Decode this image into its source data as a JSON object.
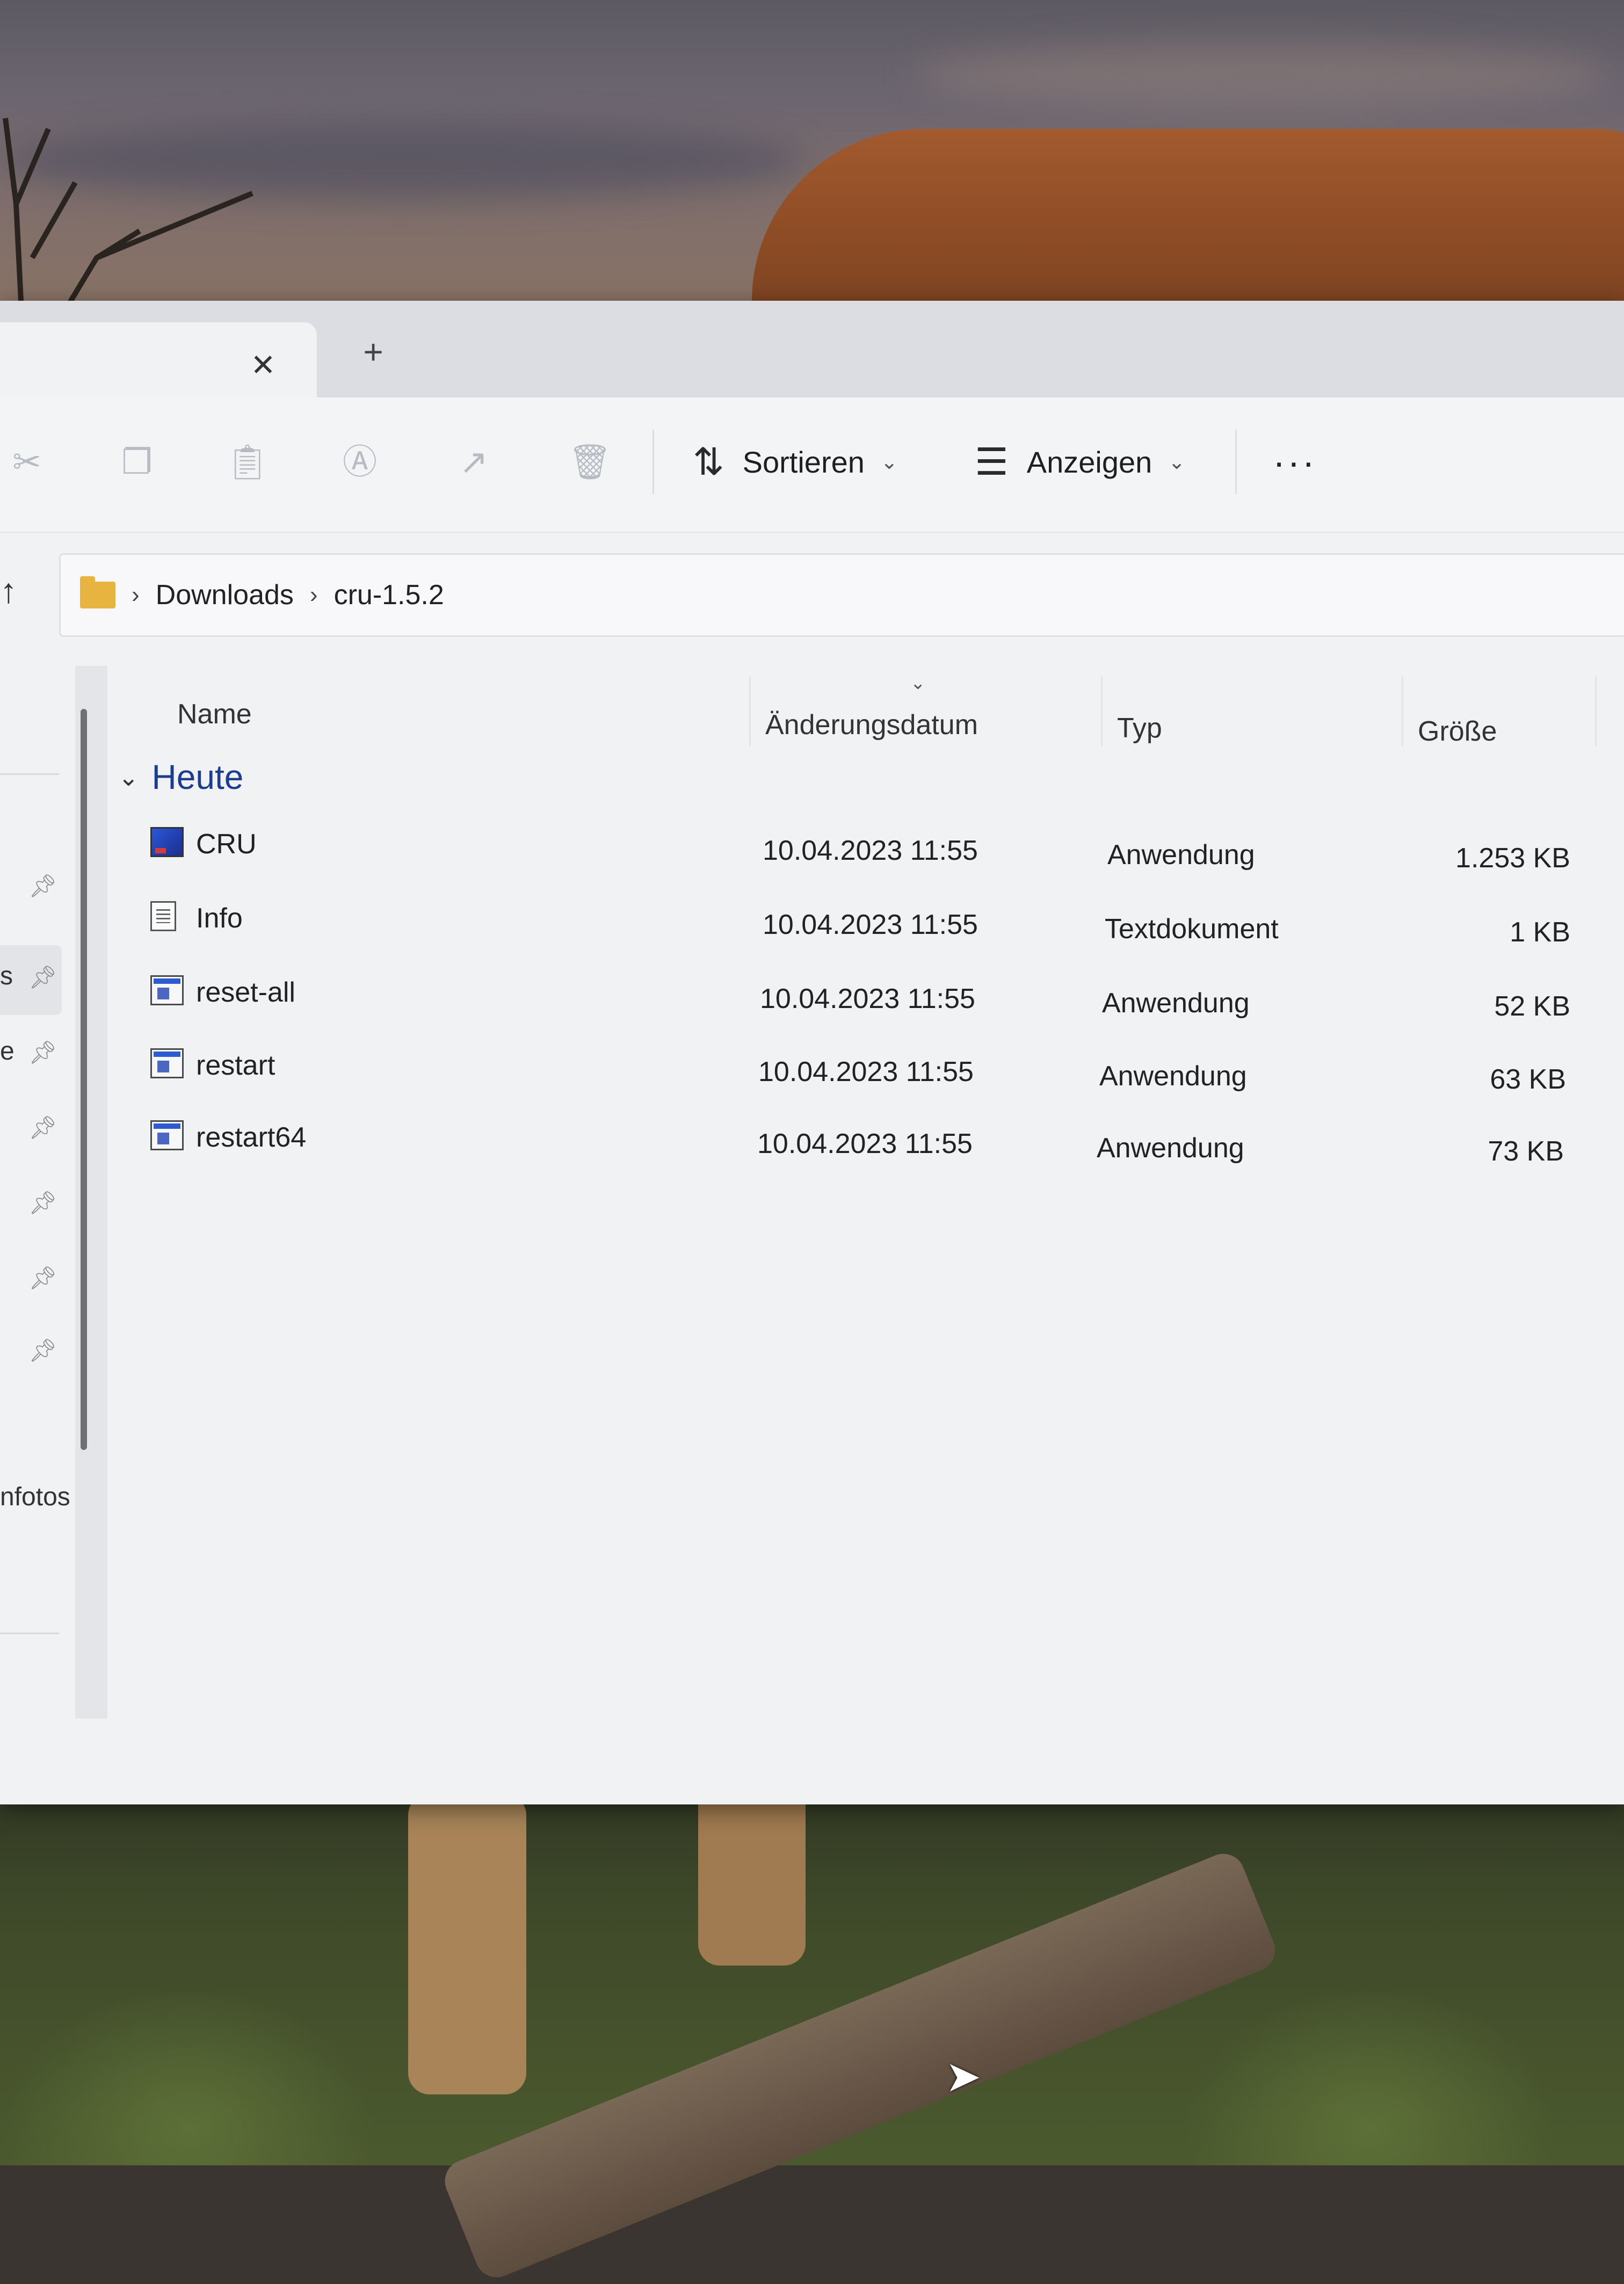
{
  "window": {
    "tab": {
      "close_glyph": "✕",
      "new_glyph": "+"
    },
    "toolbar": {
      "icons": [
        "cut-icon",
        "copy-icon",
        "paste-icon",
        "rename-icon",
        "share-icon",
        "delete-icon"
      ],
      "sort_label": "Sortieren",
      "view_label": "Anzeigen",
      "more_label": "···"
    },
    "address": {
      "up_glyph": "↑",
      "crumbs": [
        "Downloads",
        "cru-1.5.2"
      ]
    },
    "nav": {
      "partial_labels": [
        "s",
        "e",
        "nfotos"
      ]
    },
    "columns": {
      "name": "Name",
      "date": "Änderungsdatum",
      "type": "Typ",
      "size": "Größe"
    },
    "group": {
      "label": "Heute"
    },
    "files": [
      {
        "name": "CRU",
        "date": "10.04.2023 11:55",
        "type": "Anwendung",
        "size": "1.253 KB",
        "icon": "app"
      },
      {
        "name": "Info",
        "date": "10.04.2023 11:55",
        "type": "Textdokument",
        "size": "1 KB",
        "icon": "txt"
      },
      {
        "name": "reset-all",
        "date": "10.04.2023 11:55",
        "type": "Anwendung",
        "size": "52 KB",
        "icon": "bat"
      },
      {
        "name": "restart",
        "date": "10.04.2023 11:55",
        "type": "Anwendung",
        "size": "63 KB",
        "icon": "bat"
      },
      {
        "name": "restart64",
        "date": "10.04.2023 11:55",
        "type": "Anwendung",
        "size": "73 KB",
        "icon": "bat"
      }
    ]
  },
  "colors": {
    "window_bg": "#f1f2f4",
    "group_accent": "#1d3d8f",
    "folder": "#e8b440"
  }
}
